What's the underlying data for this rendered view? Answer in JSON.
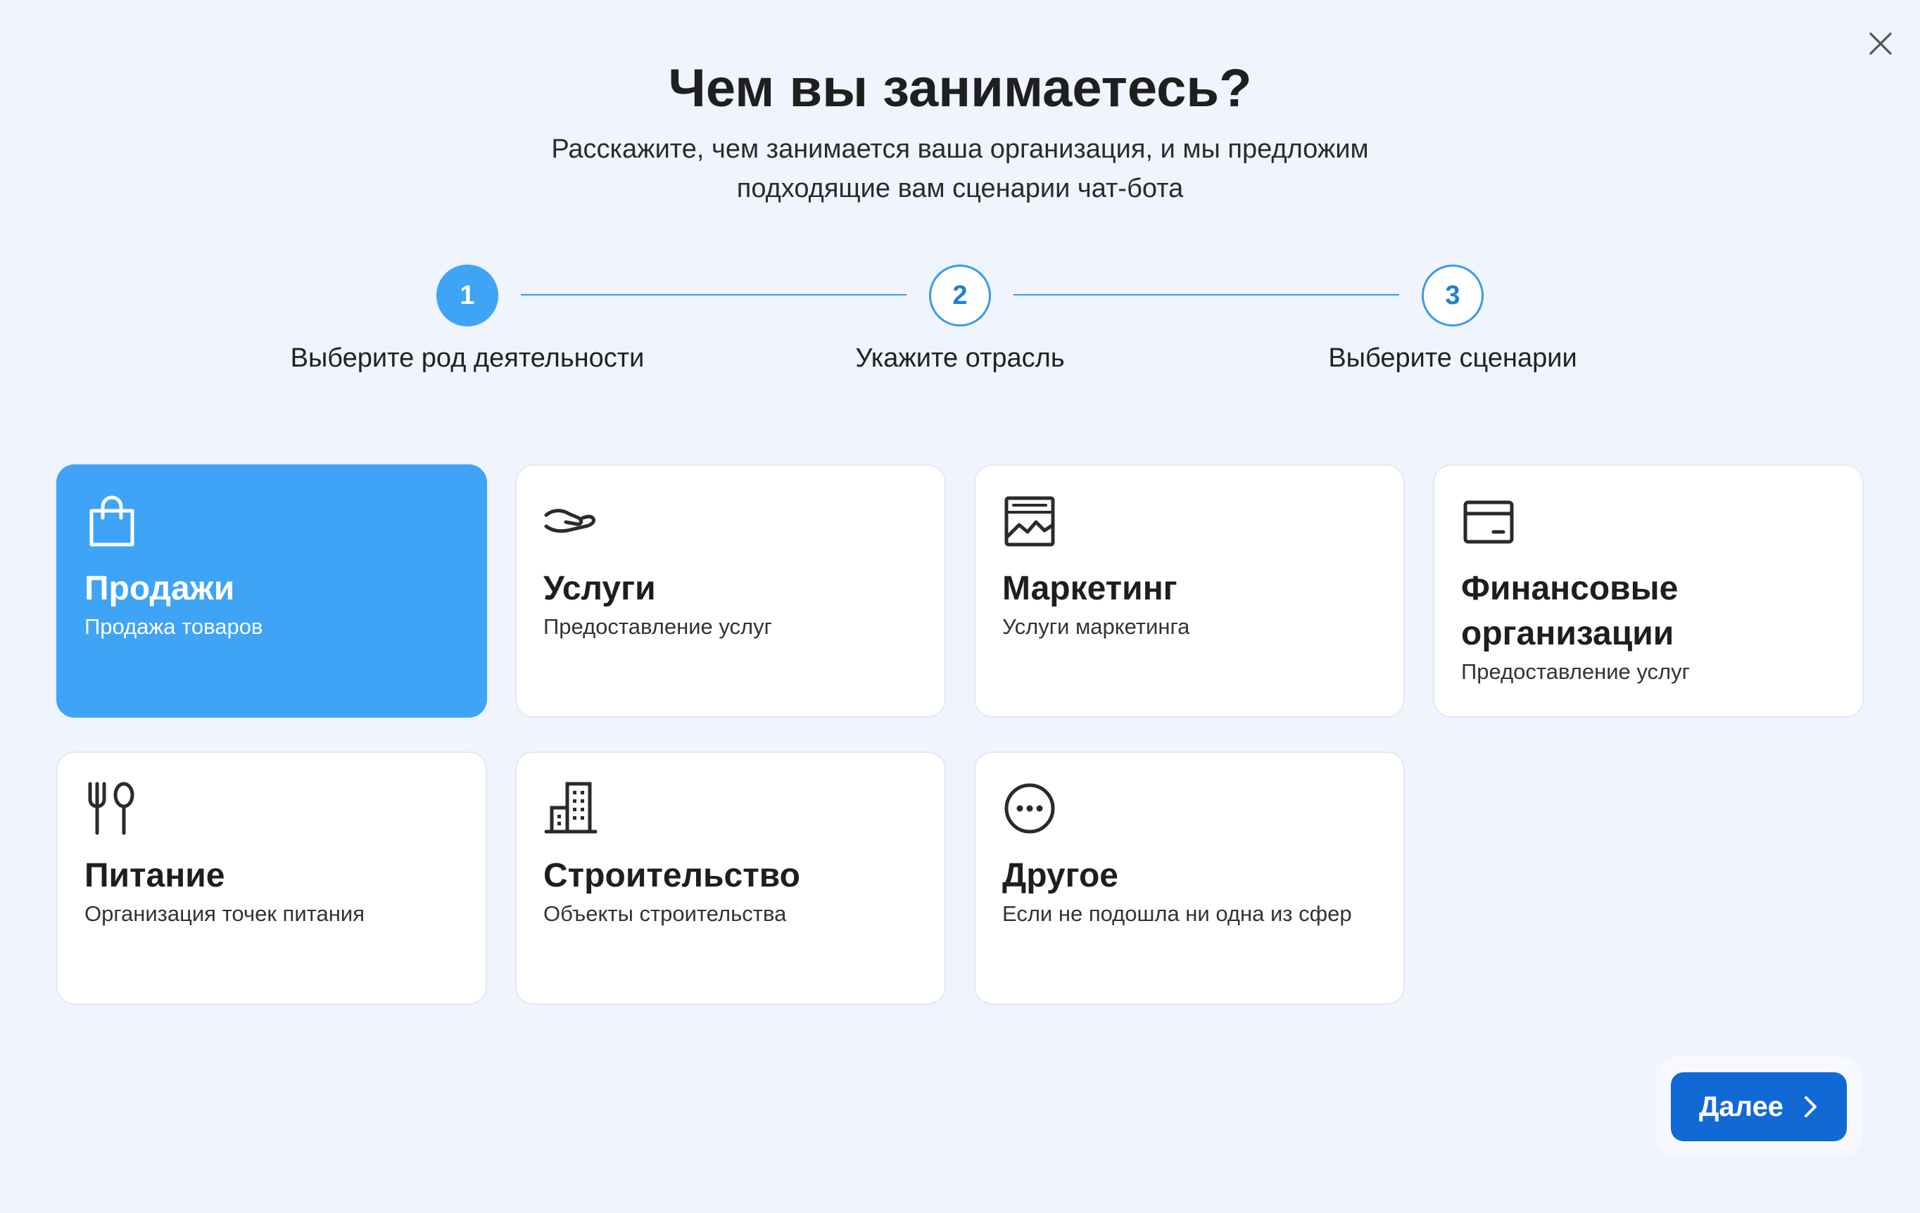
{
  "dialog": {
    "title": "Чем вы занимаетесь?",
    "subtitle_line1": "Расскажите, чем занимается ваша организация, и мы предложим",
    "subtitle_line2": "подходящие вам сценарии чат-бота",
    "close_icon": "close-icon"
  },
  "stepper": {
    "current_step": 1,
    "steps": [
      {
        "number": "1",
        "label": "Выберите род деятельности"
      },
      {
        "number": "2",
        "label": "Укажите отрасль"
      },
      {
        "number": "3",
        "label": "Выберите сценарии"
      }
    ]
  },
  "activities": [
    {
      "title": "Продажи",
      "description": "Продажа товаров",
      "icon": "shopping-bag-icon",
      "selected": true
    },
    {
      "title": "Услуги",
      "description": "Предоставление услуг",
      "icon": "hand-icon",
      "selected": false
    },
    {
      "title": "Маркетинг",
      "description": "Услуги маркетинга",
      "icon": "chart-window-icon",
      "selected": false
    },
    {
      "title_line1": "Финансовые",
      "title_line2": "организации",
      "description": "Предоставление услуг",
      "icon": "credit-card-icon",
      "selected": false
    },
    {
      "title": "Питание",
      "description": "Организация точек питания",
      "icon": "fork-spoon-icon",
      "selected": false
    },
    {
      "title": "Строительство",
      "description": "Объекты строительства",
      "icon": "building-icon",
      "selected": false
    },
    {
      "title": "Другое",
      "description": "Если не подошла ни одна из сфер",
      "icon": "more-dots-icon",
      "selected": false
    }
  ],
  "footer": {
    "next_label": "Далее",
    "next_icon": "chevron-right-icon"
  },
  "colors": {
    "accent": "#3fa3f6",
    "primary_button": "#1169d6",
    "background": "#eff4fd"
  }
}
